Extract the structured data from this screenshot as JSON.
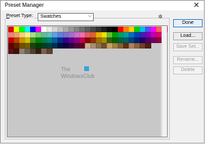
{
  "window": {
    "title": "Preset Manager",
    "close_glyph": "✕"
  },
  "preset_type": {
    "label_mnemonic": "P",
    "label_rest": "reset Type:",
    "value": "Swatches",
    "caret": "⌵",
    "gear_glyph": "✲"
  },
  "buttons": {
    "done": "Done",
    "load": "Load...",
    "save_set": "Save Set...",
    "rename": "Rename...",
    "delete": "Delete"
  },
  "watermark": {
    "line1": "The",
    "line2": "WindowsClub"
  },
  "swatches": {
    "rows": [
      [
        "#e00000",
        "#ffff00",
        "#00ff00",
        "#00ffff",
        "#0000ff",
        "#ff00ff",
        "#ffffff",
        "#ebebeb",
        "#d6d6d6",
        "#c2c2c2",
        "#adadad",
        "#999999",
        "#858585",
        "#707070",
        "#5c5c5c",
        "#474747",
        "#333333",
        "#1f1f1f",
        "#0a0a0a",
        "#000000",
        "#f20000",
        "#ff7f00",
        "#ffd000",
        "#00d000",
        "#00c0e8",
        "#5050ff",
        "#ff00ff",
        "#ff5f5f",
        "#e03070"
      ],
      [
        "#f08080",
        "#f0a070",
        "#f7d070",
        "#fff090",
        "#a8e080",
        "#70d070",
        "#60c090",
        "#60c0c0",
        "#60a0e0",
        "#6080e0",
        "#8070d0",
        "#a070d0",
        "#d070d0",
        "#f070b0",
        "#e06060",
        "#e06030",
        "#f0b000",
        "#f0e000",
        "#60c030",
        "#00a000",
        "#00a060",
        "#00a0a0",
        "#0070c0",
        "#0040c0",
        "#4020b0",
        "#8000c0",
        "#c000b0",
        "#e00070"
      ],
      [
        "#c00000",
        "#c04000",
        "#d09000",
        "#d0c000",
        "#409020",
        "#008000",
        "#008040",
        "#008080",
        "#0060a0",
        "#003090",
        "#300090",
        "#600090",
        "#900080",
        "#c00050",
        "#900000",
        "#903000",
        "#a07000",
        "#a09000",
        "#306010",
        "#006000",
        "#006040",
        "#006060",
        "#004080",
        "#002070",
        "#200070",
        "#500070",
        "#700060",
        "#900040"
      ],
      [
        "#600000",
        "#602000",
        "#705000",
        "#706000",
        "#204010",
        "#004000",
        "#004020",
        "#004040",
        "#003050",
        "#001040",
        "#100040",
        "#300040",
        "#500040",
        "#600020",
        "#c8b090",
        "#a89070",
        "#887050",
        "#705030",
        "#c8a060",
        "#a08040",
        "#806030",
        "#603010",
        "#b08060",
        "#906040",
        "#704020",
        "#502010"
      ],
      [
        "#601018",
        "#401010",
        "#908070",
        "#706050",
        "#504030",
        "#302010",
        "#806050",
        "#604030"
      ]
    ]
  }
}
